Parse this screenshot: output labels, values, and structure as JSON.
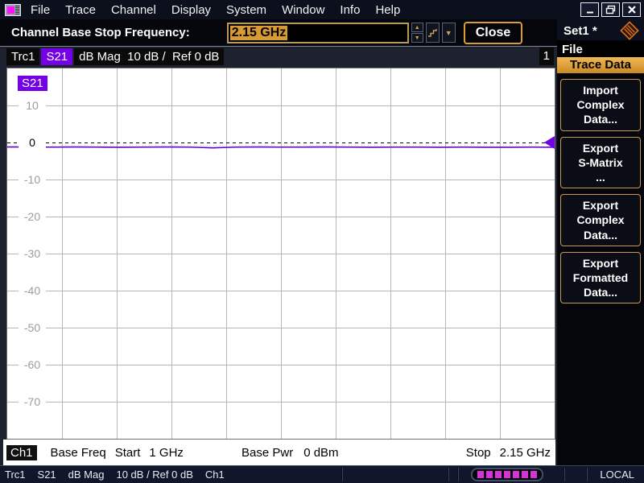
{
  "colors": {
    "selection_bg": "#d89a35",
    "accent_orange": "#dc9e32",
    "parameter_bg": "#7300e6",
    "trace_purple": "#6600cc",
    "led_magenta": "#d633d6"
  },
  "window": {
    "menu_items": [
      "File",
      "Trace",
      "Channel",
      "Display",
      "System",
      "Window",
      "Info",
      "Help"
    ]
  },
  "toolbar": {
    "label": "Channel Base Stop Frequency:",
    "input_value": "2.15 GHz",
    "close_label": "Close"
  },
  "trace_bar": {
    "trace": "Trc1",
    "parameter": "S21",
    "format": "dB Mag  10 dB /  Ref 0 dB",
    "diagram_number": "1"
  },
  "chart_data": {
    "type": "line",
    "title": "S21",
    "ylabel": "dB Mag",
    "ylim": [
      -80,
      20
    ],
    "y_ticks": [
      10,
      0,
      -10,
      -20,
      -30,
      -40,
      -50,
      -60,
      -70
    ],
    "y_step_db": 10,
    "reference_level_db": 0,
    "x_divisions": 10,
    "x_start": "1 GHz",
    "x_stop": "2.15 GHz",
    "grid": true,
    "series": [
      {
        "name": "S21",
        "values_db": [
          -1.2,
          -1.2,
          -1.25,
          -1.2,
          -1.25,
          -1.3,
          -1.25,
          -1.2,
          -1.25,
          -1.45,
          -1.25,
          -1.2,
          -1.25,
          -1.25,
          -1.2,
          -1.25,
          -1.3,
          -1.25,
          -1.25,
          -1.3,
          -1.25,
          -1.3,
          -1.3,
          -1.25,
          -1.3
        ]
      }
    ]
  },
  "channel_bar": {
    "channel": "Ch1",
    "base_freq_label": "Base Freq",
    "start_label": "Start",
    "start_value": "1 GHz",
    "base_pwr_label": "Base Pwr",
    "base_pwr_value": "0 dBm",
    "stop_label": "Stop",
    "stop_value": "2.15 GHz"
  },
  "sidebar": {
    "setup_name": "Set1 *",
    "menu_path": "File",
    "section_title": "Trace Data",
    "softkeys": [
      "Import\nComplex\nData...",
      "Export\nS-Matrix\n...",
      "Export\nComplex\nData...",
      "Export\nFormatted\nData..."
    ]
  },
  "status_bar": {
    "segments": [
      "Trc1",
      "S21",
      "dB Mag",
      "10 dB / Ref 0 dB",
      "Ch1"
    ],
    "led_count": 7,
    "mode": "LOCAL"
  }
}
